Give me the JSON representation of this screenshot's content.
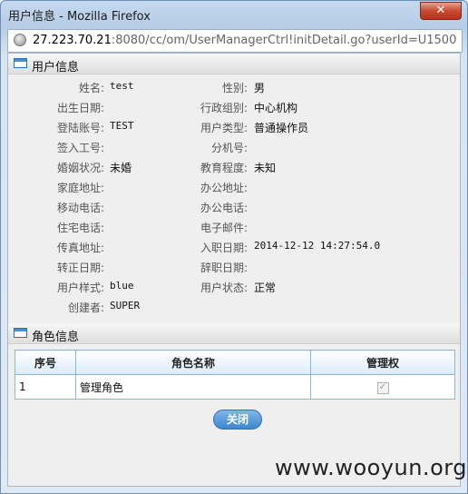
{
  "window": {
    "title": "用户信息 - Mozilla Firefox",
    "close_glyph": "✕"
  },
  "urlbar": {
    "host": "27.223.70.21",
    "rest": ":8080/cc/om/UserManagerCtrl!initDetail.go?userId=U1500"
  },
  "user_section": {
    "title": "用户信息",
    "rows": [
      {
        "l_label": "姓名:",
        "l_value": "test",
        "r_label": "性别:",
        "r_value": "男"
      },
      {
        "l_label": "出生日期:",
        "l_value": "",
        "r_label": "行政组别:",
        "r_value": "中心机构"
      },
      {
        "l_label": "登陆账号:",
        "l_value": "TEST",
        "r_label": "用户类型:",
        "r_value": "普通操作员"
      },
      {
        "l_label": "签入工号:",
        "l_value": "",
        "r_label": "分机号:",
        "r_value": ""
      },
      {
        "l_label": "婚姻状况:",
        "l_value": "未婚",
        "r_label": "教育程度:",
        "r_value": "未知"
      },
      {
        "l_label": "家庭地址:",
        "l_value": "",
        "r_label": "办公地址:",
        "r_value": ""
      },
      {
        "l_label": "移动电话:",
        "l_value": "",
        "r_label": "办公电话:",
        "r_value": ""
      },
      {
        "l_label": "住宅电话:",
        "l_value": "",
        "r_label": "电子邮件:",
        "r_value": ""
      },
      {
        "l_label": "传真地址:",
        "l_value": "",
        "r_label": "入职日期:",
        "r_value": "2014-12-12 14:27:54.0"
      },
      {
        "l_label": "转正日期:",
        "l_value": "",
        "r_label": "辞职日期:",
        "r_value": ""
      },
      {
        "l_label": "用户样式:",
        "l_value": "blue",
        "r_label": "用户状态:",
        "r_value": "正常"
      }
    ],
    "creator_label": "创建者:",
    "creator_value": "SUPER"
  },
  "role_section": {
    "title": "角色信息",
    "columns": [
      "序号",
      "角色名称",
      "管理权"
    ],
    "rows": [
      {
        "index": "1",
        "name": "管理角色",
        "checked": true,
        "check_glyph": "✓"
      }
    ]
  },
  "actions": {
    "close_label": "关闭"
  },
  "watermark": "www.wooyun.org"
}
